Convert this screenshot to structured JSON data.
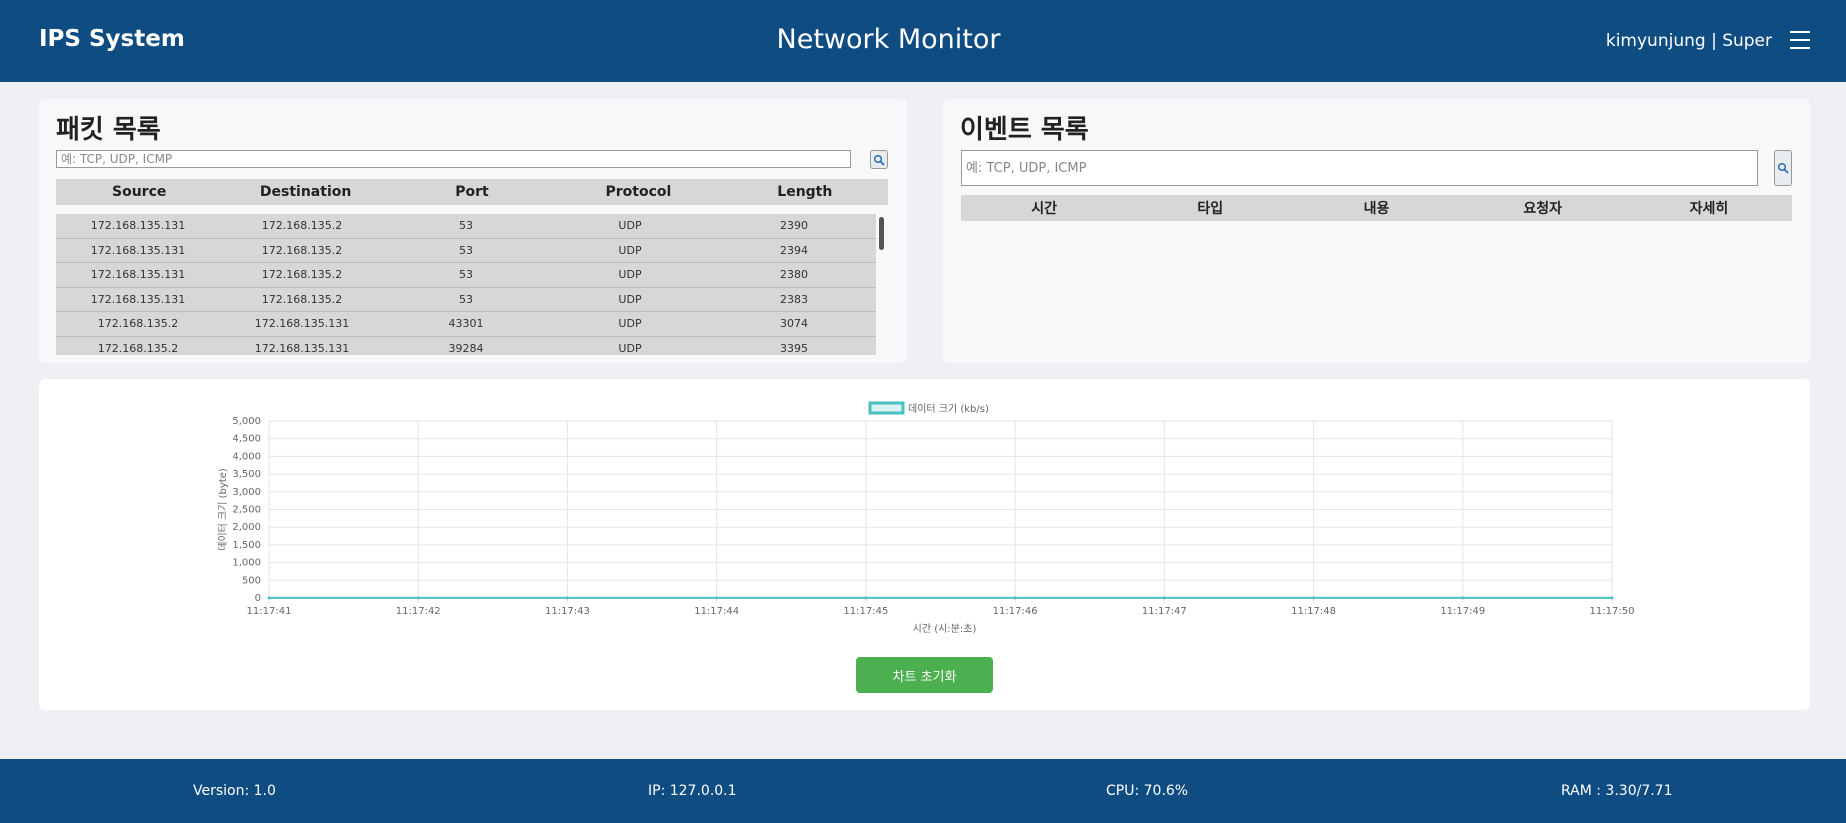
{
  "header": {
    "brand": "IPS System",
    "title": "Network Monitor",
    "user": "kimyunjung | Super"
  },
  "packets": {
    "title": "패킷 목록",
    "search_placeholder": "예: TCP, UDP, ICMP",
    "columns": [
      "Source",
      "Destination",
      "Port",
      "Protocol",
      "Length"
    ],
    "rows": [
      [
        "172.168.135.131",
        "172.168.135.2",
        "53",
        "UDP",
        "2390"
      ],
      [
        "172.168.135.131",
        "172.168.135.2",
        "53",
        "UDP",
        "2394"
      ],
      [
        "172.168.135.131",
        "172.168.135.2",
        "53",
        "UDP",
        "2380"
      ],
      [
        "172.168.135.131",
        "172.168.135.2",
        "53",
        "UDP",
        "2383"
      ],
      [
        "172.168.135.2",
        "172.168.135.131",
        "43301",
        "UDP",
        "3074"
      ],
      [
        "172.168.135.2",
        "172.168.135.131",
        "39284",
        "UDP",
        "3395"
      ]
    ]
  },
  "events": {
    "title": "이벤트 목록",
    "search_placeholder": "예: TCP, UDP, ICMP",
    "columns": [
      "시간",
      "타입",
      "내용",
      "요청자",
      "자세히"
    ]
  },
  "chart_data": {
    "type": "line",
    "legend": "데이터 크기 (kb/s)",
    "xlabel": "시간 (시:분:초)",
    "ylabel": "데이터 크기 (byte)",
    "x": [
      "11:17:41",
      "11:17:42",
      "11:17:43",
      "11:17:44",
      "11:17:45",
      "11:17:46",
      "11:17:47",
      "11:17:48",
      "11:17:49",
      "11:17:50"
    ],
    "series": [
      {
        "name": "데이터 크기 (kb/s)",
        "values": [
          5,
          5,
          5,
          5,
          5,
          5,
          5,
          5,
          5,
          5
        ]
      }
    ],
    "yticks": [
      "0",
      "500",
      "1,000",
      "1,500",
      "2,000",
      "2,500",
      "3,000",
      "3,500",
      "4,000",
      "4,500",
      "5,000"
    ],
    "ylim": [
      0,
      5000
    ],
    "grid": true,
    "legend_position": "top",
    "line_color": "#4bc0c0"
  },
  "chart_reset_label": "차트 초기화",
  "footer": {
    "version": "Version: 1.0",
    "ip": "IP: 127.0.0.1",
    "cpu": "CPU: 70.6%",
    "ram": "RAM : 3.30/7.71"
  }
}
